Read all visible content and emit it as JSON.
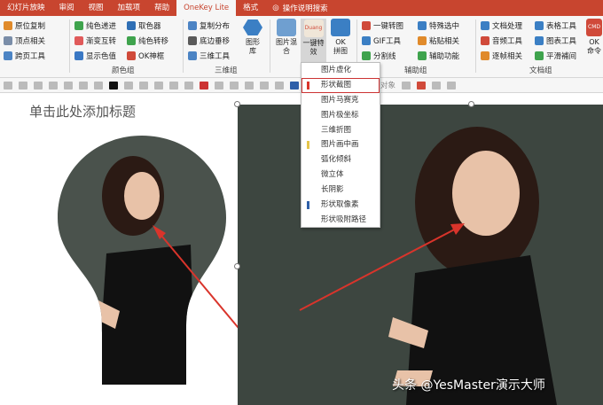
{
  "tabs": [
    "幻灯片放映",
    "审阅",
    "视图",
    "加载项",
    "帮助",
    "OneKey Lite",
    "格式"
  ],
  "active_tab_index": 5,
  "tell_me": "操作说明搜索",
  "ribbon": {
    "col1": [
      "原位复制",
      "顶点相关",
      "跨页工具"
    ],
    "col2": [
      "纯色递进",
      "渐变互转",
      "显示色值"
    ],
    "col3": [
      "取色器",
      "纯色转移",
      "OK神框"
    ],
    "group1": "颜色组",
    "col4": [
      "复制分布",
      "底边垂移",
      "三维工具"
    ],
    "tuxingku": "图形库",
    "group2": "三维组",
    "image_mix": "图片混合",
    "one_key_effect": "一键特效",
    "ok_image": "OK拼图",
    "duang": "Duang",
    "col5": [
      "一键转图",
      "GIF工具",
      "分割线"
    ],
    "col6": [
      "特殊选中",
      "粘贴相关",
      "辅助功能"
    ],
    "group3": "辅助组",
    "col7": [
      "文档处理",
      "音频工具",
      "逐帧相关"
    ],
    "col8": [
      "表格工具",
      "图表工具",
      "平滑補间"
    ],
    "group4": "文档组",
    "cmd": "CMD",
    "ok_cmd": "OK命令"
  },
  "format_bar": {
    "align_objects": "对齐所选对象"
  },
  "dropdown": [
    {
      "label": "图片虚化",
      "mark": ""
    },
    {
      "label": "形状截图",
      "mark": "#d9342b",
      "selected": true
    },
    {
      "label": "图片马赛克",
      "mark": ""
    },
    {
      "label": "图片极坐标",
      "mark": ""
    },
    {
      "label": "三维折图",
      "mark": ""
    },
    {
      "label": "图片画中画",
      "mark": "#e5c54a"
    },
    {
      "label": "弧化倾斜",
      "mark": ""
    },
    {
      "label": "微立体",
      "mark": ""
    },
    {
      "label": "长阴影",
      "mark": ""
    },
    {
      "label": "形状取像素",
      "mark": "#2e5fa8"
    },
    {
      "label": "形状吸附路径",
      "mark": ""
    }
  ],
  "slide": {
    "title": "单击此处添加标题"
  },
  "watermark": "头条 @YesMaster演示大师",
  "colors": {
    "accent": "#c8452f",
    "bulb_bg": "#4a524c",
    "photo_bg": "#3d4640",
    "arrow": "#d9342b"
  }
}
